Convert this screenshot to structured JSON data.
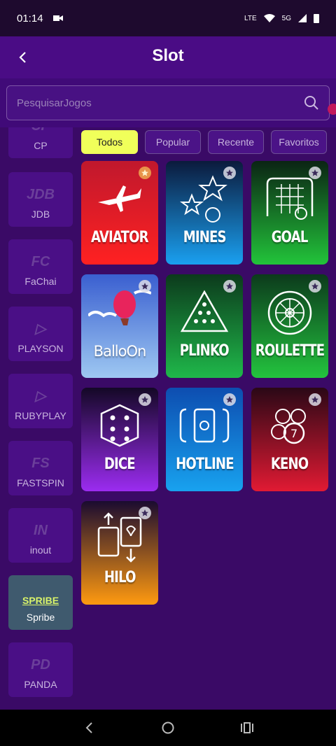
{
  "status": {
    "time": "01:14",
    "network": "LTE",
    "signal": "5G"
  },
  "header": {
    "title": "Slot"
  },
  "search": {
    "placeholder": "PesquisarJogos"
  },
  "tabs": [
    {
      "label": "Todos",
      "active": true
    },
    {
      "label": "Popular",
      "active": false
    },
    {
      "label": "Recente",
      "active": false
    },
    {
      "label": "Favoritos",
      "active": false
    }
  ],
  "providers": [
    {
      "logo": "CP",
      "name": "CP"
    },
    {
      "logo": "JDB",
      "name": "JDB"
    },
    {
      "logo": "FC",
      "name": "FaChai"
    },
    {
      "logo": "▷",
      "name": "PLAYSON"
    },
    {
      "logo": "▷",
      "name": "RUBYPLAY"
    },
    {
      "logo": "FS",
      "name": "FASTSPIN"
    },
    {
      "logo": "IN",
      "name": "inout"
    },
    {
      "logo": "SPRIBE",
      "name": "Spribe",
      "active": true
    },
    {
      "logo": "PD",
      "name": "PANDA"
    }
  ],
  "games": [
    {
      "name": "AVIATOR",
      "fav": true,
      "gradient": [
        "#c0182d",
        "#ff2121"
      ]
    },
    {
      "name": "MINES",
      "fav": false,
      "gradient": [
        "#0b1a3c",
        "#1aa0f0"
      ]
    },
    {
      "name": "GOAL",
      "fav": false,
      "gradient": [
        "#0b2414",
        "#22c43a"
      ]
    },
    {
      "name": "BalloOn",
      "fav": false,
      "gradient": [
        "#3a5fd0",
        "#9ec8f2"
      ]
    },
    {
      "name": "PLINKO",
      "fav": false,
      "gradient": [
        "#0c3a1c",
        "#1fb84a"
      ]
    },
    {
      "name": "ROULETTE",
      "fav": false,
      "gradient": [
        "#0c3a1c",
        "#23c43e"
      ]
    },
    {
      "name": "DICE",
      "fav": false,
      "gradient": [
        "#140826",
        "#9b2cf0"
      ]
    },
    {
      "name": "HOTLINE",
      "fav": false,
      "gradient": [
        "#0d4db0",
        "#18a2ef"
      ]
    },
    {
      "name": "KENO",
      "fav": false,
      "gradient": [
        "#2a0816",
        "#e11a33"
      ]
    },
    {
      "name": "HILO",
      "fav": false,
      "gradient": [
        "#1a0b30",
        "#ff9a10"
      ]
    }
  ]
}
